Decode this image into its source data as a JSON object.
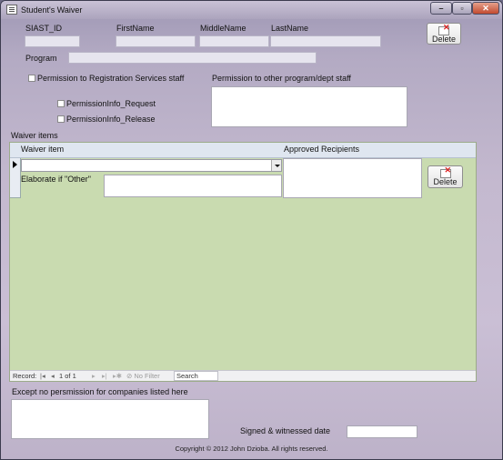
{
  "window": {
    "title": "Student's Waiver",
    "min": "–",
    "max": "▫",
    "close": "✕"
  },
  "header": {
    "siast_id_label": "SIAST_ID",
    "first_name_label": "FirstName",
    "middle_name_label": "MiddleName",
    "last_name_label": "LastName",
    "program_label": "Program",
    "delete_label": "Delete"
  },
  "permissions": {
    "registration_label": "Permission to Registration Services staff",
    "request_label": "PermissionInfo_Request",
    "release_label": "PermissionInfo_Release",
    "other_label": "Permission to other program/dept staff"
  },
  "waiver": {
    "section_label": "Waiver items",
    "col_item": "Waiver item",
    "col_recipients": "Approved Recipients",
    "elaborate_label": "Elaborate if \"Other\"",
    "delete_label": "Delete"
  },
  "navbar": {
    "record_label": "Record:",
    "first": "|◂",
    "prev": "◂",
    "position": "1 of 1",
    "next": "▸",
    "last": "▸|",
    "new": "▸✱",
    "filter_icon": "⊘",
    "filter_label": "No Filter",
    "search_label": "Search"
  },
  "footer": {
    "except_label": "Except no persmission for companies listed here",
    "signed_label": "Signed & witnessed date",
    "copyright": "Copyright © 2012 John Dzioba. All rights reserved."
  }
}
